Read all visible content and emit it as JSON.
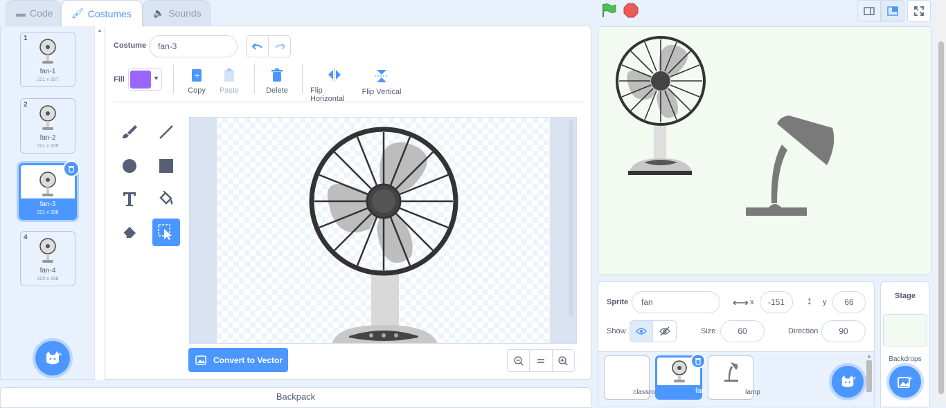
{
  "tabs": [
    {
      "label": "Code"
    },
    {
      "label": "Costumes"
    },
    {
      "label": "Sounds"
    }
  ],
  "costumes": [
    {
      "num": "1",
      "name": "fan-1",
      "size": "221 x 337"
    },
    {
      "num": "2",
      "name": "fan-2",
      "size": "221 x 339"
    },
    {
      "num": "3",
      "name": "fan-3",
      "size": "221 x 338"
    },
    {
      "num": "4",
      "name": "fan-4",
      "size": "220 x 338"
    }
  ],
  "editor": {
    "costume_label": "Costume",
    "costume_name": "fan-3",
    "fill_label": "Fill",
    "fill_color": "#9966ff",
    "copy": "Copy",
    "paste": "Paste",
    "delete": "Delete",
    "flip_h": "Flip Horizontal",
    "flip_v": "Flip Vertical",
    "convert": "Convert to Vector"
  },
  "backpack": "Backpack",
  "sprite_info": {
    "sprite_label": "Sprite",
    "sprite_name": "fan",
    "x_label": "x",
    "x": "-151",
    "y_label": "y",
    "y": "66",
    "show_label": "Show",
    "size_label": "Size",
    "size": "60",
    "direction_label": "Direction",
    "direction": "90"
  },
  "sprites": [
    {
      "name": "classroom"
    },
    {
      "name": "fan"
    },
    {
      "name": "lamp"
    }
  ],
  "stage_panel": {
    "title": "Stage",
    "backdrops": "Backdrops"
  },
  "colors": {
    "accent": "#4c97ff",
    "purple": "#855cd6",
    "green_flag": "#4cbf56",
    "stop": "#ec5959"
  }
}
